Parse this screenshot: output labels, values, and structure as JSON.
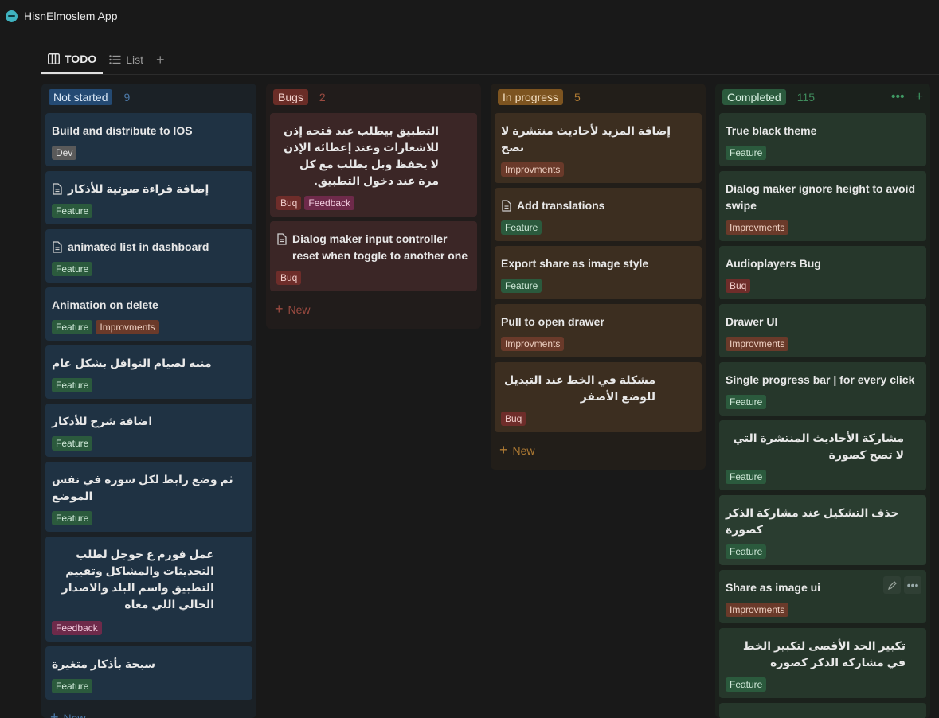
{
  "app": {
    "title": "HisnElmoslem App"
  },
  "views": [
    {
      "label": "TODO"
    },
    {
      "label": "List"
    }
  ],
  "columns": {
    "not_started": {
      "label": "Not started",
      "count": "9",
      "new_label": "New",
      "cards": [
        {
          "title": "Build and distribute to IOS",
          "tags": [
            "Dev"
          ]
        },
        {
          "title": "إضافة قراءة صوتية للأذكار",
          "tags": [
            "Feature"
          ]
        },
        {
          "title": "animated list in dashboard",
          "tags": [
            "Feature"
          ]
        },
        {
          "title": "Animation on delete",
          "tags": [
            "Feature",
            "Improvments"
          ]
        },
        {
          "title": "منبه لصيام النوافل بشكل عام",
          "tags": [
            "Feature"
          ]
        },
        {
          "title": "اضافة شرح للأذكار",
          "tags": [
            "Feature"
          ]
        },
        {
          "title": "ثم وضع رابط لكل سورة في نفس الموضع",
          "tags": [
            "Feature"
          ]
        },
        {
          "title": "عمل فورم ع جوجل لطلب التحديثات والمشاكل وتقييم التطبيق واسم البلد والاصدار الحالي اللي معاه",
          "tags": [
            "Feedback"
          ]
        },
        {
          "title": "سبحة بأذكار متغيرة",
          "tags": [
            "Feature"
          ]
        }
      ]
    },
    "bugs": {
      "label": "Bugs",
      "count": "2",
      "new_label": "New",
      "cards": [
        {
          "title": "التطبيق بيطلب عند فتحه إذن للاشعارات وعند إعطائه الإذن لا يحفظ وبل يطلب مع كل مرة عند دخول التطبيق.",
          "tags": [
            "Buq",
            "Feedback"
          ]
        },
        {
          "title": "Dialog maker input controller reset when toggle to another one",
          "tags": [
            "Buq"
          ]
        }
      ]
    },
    "in_progress": {
      "label": "In progress",
      "count": "5",
      "new_label": "New",
      "cards": [
        {
          "title": "إضافة المزيد  لأحاديث منتشرة لا تصح",
          "tags": [
            "Improvments"
          ]
        },
        {
          "title": "Add translations",
          "tags": [
            "Feature"
          ]
        },
        {
          "title": "Export share as image style",
          "tags": [
            "Feature"
          ]
        },
        {
          "title": "Pull to open drawer",
          "tags": [
            "Improvments"
          ]
        },
        {
          "title": "مشكلة في الخط عند التبديل للوضع الأصفر",
          "tags": [
            "Buq"
          ]
        }
      ]
    },
    "completed": {
      "label": "Completed",
      "count": "115",
      "cards": [
        {
          "title": "True black theme",
          "tags": [
            "Feature"
          ]
        },
        {
          "title": "Dialog maker ignore height to avoid swipe",
          "tags": [
            "Improvments"
          ]
        },
        {
          "title": "Audioplayers Bug",
          "tags": [
            "Buq"
          ]
        },
        {
          "title": "Drawer UI",
          "tags": [
            "Improvments"
          ]
        },
        {
          "title": "Single progress bar | for every click",
          "tags": [
            "Feature"
          ]
        },
        {
          "title": "مشاركة الأحاديث المنتشرة التي لا تصح كصورة",
          "tags": [
            "Feature"
          ]
        },
        {
          "title": "حذف التشكيل عند مشاركة الذكر كصورة",
          "tags": [
            "Feature"
          ]
        },
        {
          "title": "Share as image ui",
          "tags": [
            "Improvments"
          ]
        },
        {
          "title": "تكبير الحد الأقصى لتكبير الخط في مشاركة الذكر كصورة",
          "tags": [
            "Feature"
          ]
        }
      ]
    }
  },
  "colors": {
    "background": "#191919",
    "blue_card": "#1f3243",
    "red_card": "#3b2626",
    "brown_card": "#3c2e20",
    "green_card": "#26372b"
  }
}
